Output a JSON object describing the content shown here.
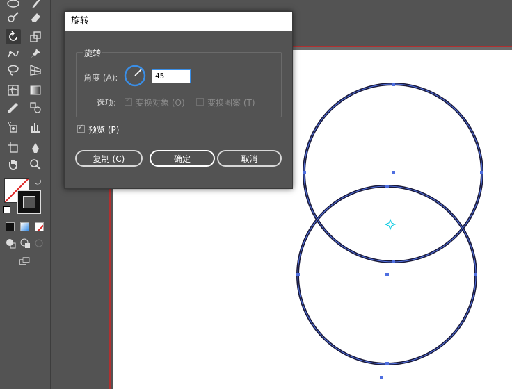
{
  "dialog": {
    "title": "旋转",
    "group_label": "旋转",
    "angle_label": "角度 (A):",
    "angle_value": "45",
    "options_label": "选项:",
    "transform_objects": "变换对象 (O)",
    "transform_patterns": "变换图案 (T)",
    "preview_label": "预览 (P)",
    "copy_button": "复制 (C)",
    "ok_button": "确定",
    "cancel_button": "取消"
  },
  "colors": {
    "ui_bg": "#535353",
    "accent_blue": "#3a8ee6",
    "artboard_guide": "#b03030",
    "stroke": "#1a1a3a",
    "selection": "#4f6fe0"
  },
  "tools": [
    "ellipse-tool-icon",
    "paintbrush-tool-icon",
    "blob-brush-tool-icon",
    "eraser-tool-icon",
    "rotate-tool-icon",
    "scale-tool-icon",
    "puppet-warp-tool-icon",
    "pin-tool-icon",
    "lasso-tool-icon",
    "perspective-grid-tool-icon",
    "mesh-tool-icon",
    "gradient-tool-icon",
    "eyedropper-tool-icon",
    "blend-tool-icon",
    "symbol-sprayer-tool-icon",
    "column-graph-tool-icon",
    "artboard-tool-icon",
    "slice-tool-icon",
    "hand-tool-icon",
    "zoom-tool-icon"
  ]
}
